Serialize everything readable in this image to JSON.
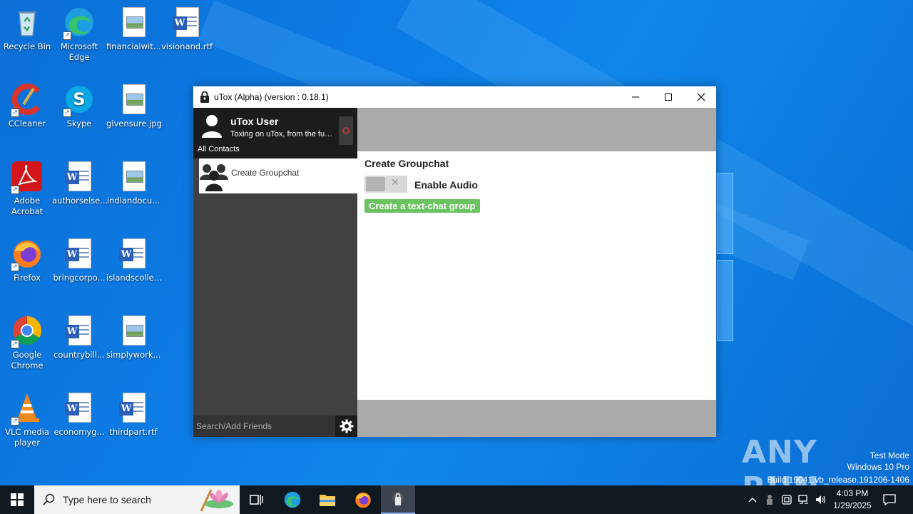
{
  "desktop": {
    "icons": [
      {
        "label": "Recycle Bin",
        "icon": "recycle-bin-icon"
      },
      {
        "label": "Microsoft Edge",
        "icon": "edge-icon"
      },
      {
        "label": "financialwit...",
        "icon": "image-file-icon"
      },
      {
        "label": "visionand.rtf",
        "icon": "word-file-icon"
      },
      {
        "label": "CCleaner",
        "icon": "ccleaner-icon"
      },
      {
        "label": "Skype",
        "icon": "skype-icon"
      },
      {
        "label": "givensure.jpg",
        "icon": "image-file-icon"
      },
      {
        "label": "Adobe Acrobat",
        "icon": "acrobat-icon"
      },
      {
        "label": "authorselse...",
        "icon": "word-file-icon"
      },
      {
        "label": "indiandocu...",
        "icon": "image-file-icon"
      },
      {
        "label": "Firefox",
        "icon": "firefox-icon"
      },
      {
        "label": "bringcorpo...",
        "icon": "word-file-icon"
      },
      {
        "label": "islandscolle...",
        "icon": "word-file-icon"
      },
      {
        "label": "Google Chrome",
        "icon": "chrome-icon"
      },
      {
        "label": "countrybill...",
        "icon": "word-file-icon"
      },
      {
        "label": "simplywork...",
        "icon": "image-file-icon"
      },
      {
        "label": "VLC media player",
        "icon": "vlc-icon"
      },
      {
        "label": "economyg...",
        "icon": "word-file-icon"
      },
      {
        "label": "thirdpart.rtf",
        "icon": "word-file-icon"
      }
    ]
  },
  "window": {
    "title": "uTox (Alpha) (version : 0.18.1)",
    "minimize": "—",
    "maximize": "☐",
    "close": "✕"
  },
  "sidebar": {
    "user_name": "uTox User",
    "status_message": "Toxing on uTox, from the future!",
    "filter_label": "All Contacts",
    "items": [
      {
        "label": "Create Groupchat"
      }
    ],
    "search_placeholder": "Search/Add Friends"
  },
  "main": {
    "heading": "Create Groupchat",
    "toggle_label": "Enable Audio",
    "toggle_state": "off",
    "create_button": "Create a text-chat group"
  },
  "watermark": {
    "logo": "ANY RUN",
    "test_mode": "Test Mode",
    "edition": "Windows 10 Pro",
    "build": "Build 19041.vb_release.191206-1406"
  },
  "taskbar": {
    "search_placeholder": "Type here to search",
    "time": "4:03 PM",
    "date": "1/29/2025"
  },
  "colors": {
    "accent_green": "#6bc260",
    "sidebar_bg": "#414141",
    "header_gray": "#aaaaaa",
    "desktop_blue": "#0b74d9"
  }
}
